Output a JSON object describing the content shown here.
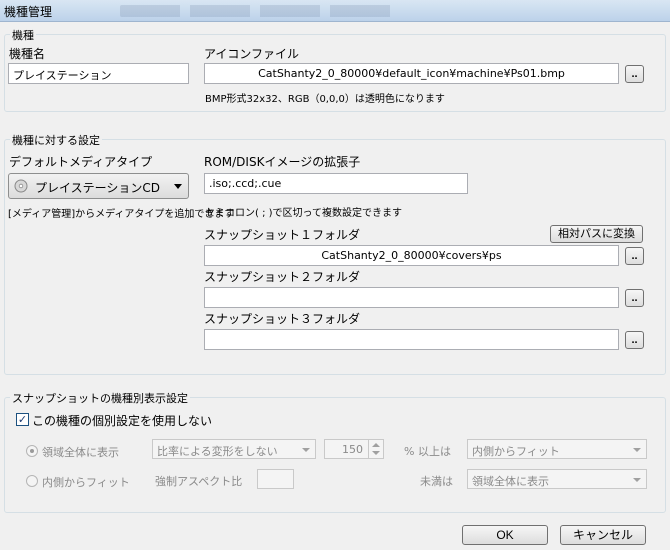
{
  "window": {
    "title": "機種管理"
  },
  "machine_group": {
    "legend": "機種",
    "name_label": "機種名",
    "name_value": "プレイステーション",
    "icon_label": "アイコンファイル",
    "icon_value": "CatShanty2_0_80000¥default_icon¥machine¥Ps01.bmp",
    "icon_browse": "..",
    "icon_hint": "BMP形式32x32、RGB（0,0,0）は透明色になります"
  },
  "settings_group": {
    "legend": "機種に対する設定",
    "default_media_label": "デフォルトメディアタイプ",
    "default_media_value": "プレイステーションCD",
    "media_hint": "[メディア管理]からメディアタイプを追加できます",
    "ext_label": "ROM/DISKイメージの拡張子",
    "ext_value": ".iso;.ccd;.cue",
    "ext_hint": "セミコロン( ; )で区切って複数設定できます",
    "relative_button": "相対パスに変換",
    "snap1_label": "スナップショット１フォルダ",
    "snap1_value": "CatShanty2_0_80000¥covers¥ps",
    "snap2_label": "スナップショット２フォルダ",
    "snap2_value": "",
    "snap3_label": "スナップショット３フォルダ",
    "snap3_value": "",
    "browse": ".."
  },
  "snapshot_group": {
    "legend": "スナップショットの機種別表示設定",
    "checkbox_label": "この機種の個別設定を使用しない",
    "checkbox_mark": "✓",
    "radio1_label": "領域全体に表示",
    "radio2_label": "内側からフィット",
    "ratio_select": "比率による変形をしない",
    "spin_value": "150",
    "percent_label": "% 以上は",
    "over_select": "内側からフィット",
    "forced_aspect_label": "強制アスペクト比",
    "forced_aspect_value": "",
    "under_label": "未満は",
    "under_select": "領域全体に表示"
  },
  "footer": {
    "ok": "OK",
    "cancel": "キャンセル"
  }
}
